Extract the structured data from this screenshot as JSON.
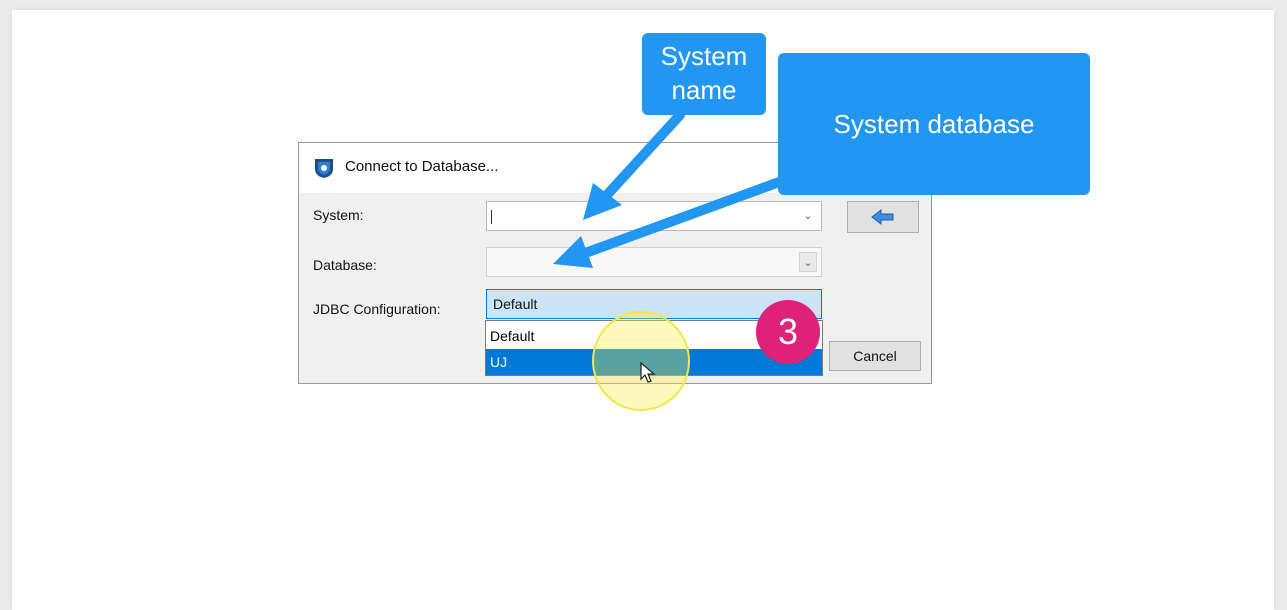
{
  "dialog": {
    "title": "Connect to Database...",
    "fields": {
      "system_label": "System:",
      "system_value": "",
      "database_label": "Database:",
      "database_value": "",
      "jdbc_label": "JDBC Configuration:",
      "jdbc_value": "Default"
    },
    "dropdown_options": [
      "Default",
      "UJ"
    ],
    "selected_option": "UJ",
    "cancel_label": "Cancel"
  },
  "annotations": {
    "callout_system_name": "System name",
    "callout_system_database": "System database",
    "step_badge": "3"
  },
  "colors": {
    "callout": "#2196f3",
    "badge": "#e0217a",
    "selection": "#0078d7",
    "highlight": "#f1e84a"
  },
  "icons": {
    "app": "database-connect-icon",
    "back": "back-arrow-icon",
    "cursor": "mouse-pointer-icon"
  }
}
